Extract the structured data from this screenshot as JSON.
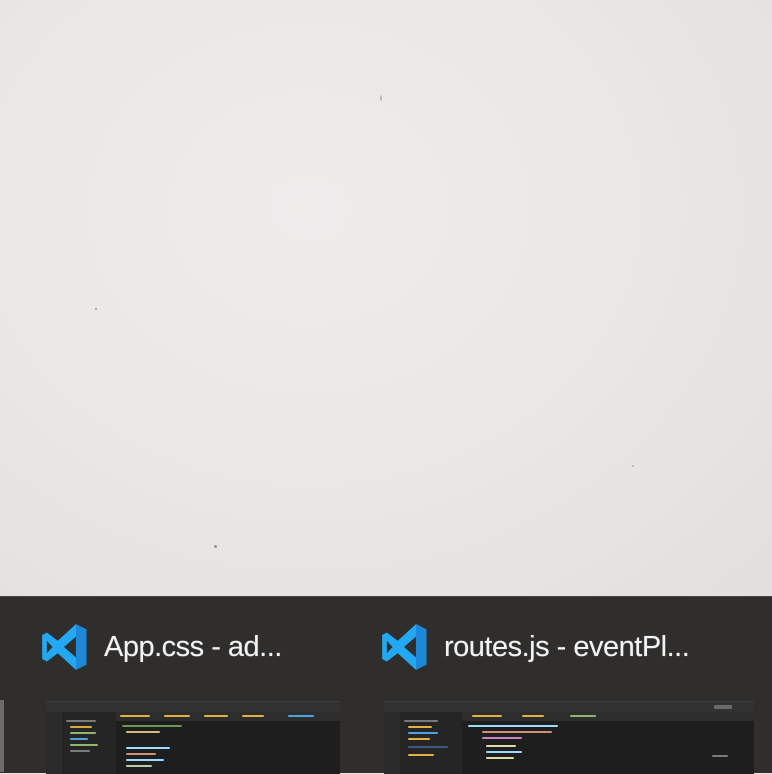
{
  "window_previews": [
    {
      "app_icon": "vscode-icon",
      "title": "App.css - ad...",
      "accent": "#23a9f2"
    },
    {
      "app_icon": "vscode-icon",
      "title": "routes.js - eventPl...",
      "accent": "#23a9f2"
    }
  ],
  "colors": {
    "wallpaper": "#ebe9e7",
    "taskbar_preview_bg": "#2f2e2d",
    "editor_bg": "#1e1e1e",
    "title_text": "#f3f3f3"
  }
}
